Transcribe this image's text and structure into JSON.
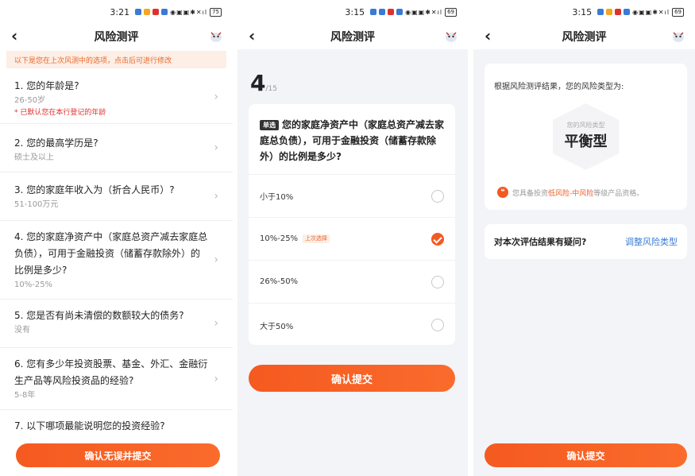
{
  "colors": {
    "accent": "#f15a22",
    "link": "#3a7bd5",
    "notice_bg": "#fdeee6",
    "required": "#e0312f"
  },
  "screens": [
    {
      "status": {
        "time": "3:21",
        "battery": "75"
      },
      "nav": {
        "title": "风险测评",
        "back_icon": "chevron-left-icon",
        "mascot_icon": "mascot-icon"
      },
      "notice": "以下是您在上次风测中的选项，点击后可进行修改",
      "questions": [
        {
          "title": "1. 您的年龄是?",
          "answer": "26-50岁",
          "note": "* 已默认您在本行登记的年龄"
        },
        {
          "title": "2. 您的最高学历是?",
          "answer": "硕士及以上"
        },
        {
          "title": "3. 您的家庭年收入为（折合人民币）?",
          "answer": "51-100万元"
        },
        {
          "title": "4. 您的家庭净资产中（家庭总资产减去家庭总负债），可用于金融投资（储蓄存款除外）的比例是多少?",
          "answer": "10%-25%"
        },
        {
          "title": "5. 您是否有尚未清偿的数额较大的债务?",
          "answer": "没有"
        },
        {
          "title": "6. 您有多少年投资股票、基金、外汇、金融衍生产品等风险投资品的经验?",
          "answer": "5-8年"
        },
        {
          "title": "7. 以下哪项最能说明您的投资经验?",
          "answer": ""
        }
      ],
      "confirm_button": "确认无误并提交"
    },
    {
      "status": {
        "time": "3:15",
        "battery": "69"
      },
      "nav": {
        "title": "风险测评",
        "back_icon": "chevron-left-icon",
        "mascot_icon": "mascot-icon"
      },
      "progress": {
        "current": "4",
        "total": "/15"
      },
      "question": {
        "tag": "单选",
        "text": "您的家庭净资产中（家庭总资产减去家庭总负债），可用于金融投资（储蓄存款除外）的比例是多少?",
        "options": [
          {
            "label": "小于10%",
            "last_tag": "",
            "checked": false
          },
          {
            "label": "10%-25%",
            "last_tag": "上次选择",
            "checked": true
          },
          {
            "label": "26%-50%",
            "last_tag": "",
            "checked": false
          },
          {
            "label": "大于50%",
            "last_tag": "",
            "checked": false
          }
        ]
      },
      "submit_button": "确认提交"
    },
    {
      "status": {
        "time": "3:15",
        "battery": "69"
      },
      "nav": {
        "title": "风险测评",
        "back_icon": "chevron-left-icon",
        "mascot_icon": "mascot-icon"
      },
      "result": {
        "intro": "根据风险测评结果，您的风险类型为:",
        "badge_label": "您的风险类型",
        "type": "平衡型",
        "desc_prefix": "您具备投资",
        "desc_highlight": "低风险-中风险",
        "desc_suffix": "等级产品资格。",
        "quote_icon": "quote-icon"
      },
      "doubt": {
        "question": "对本次评估结果有疑问?",
        "action": "调整风险类型"
      },
      "submit_button": "确认提交"
    }
  ]
}
